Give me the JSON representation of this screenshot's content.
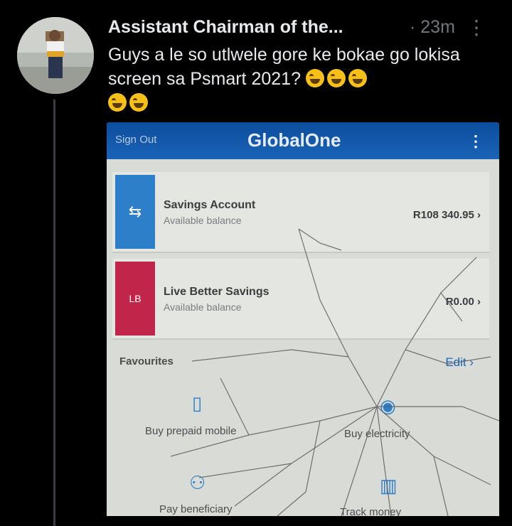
{
  "tweet": {
    "author": "Assistant Chairman of the...",
    "time": "· 23m",
    "more_icon": "more-vertical-icon",
    "text": "Guys a le so utlwele gore ke bokae go lokisa screen sa Psmart 2021?",
    "emoji": "rolling-on-floor-laughing"
  },
  "photo": {
    "sign_out": "Sign Out",
    "app_title": "GlobalOne",
    "accounts": [
      {
        "name": "Savings Account",
        "sub": "Available balance",
        "balance": "R108 340.95",
        "icon": "transfer-icon"
      },
      {
        "name": "Live Better Savings",
        "sub": "Available balance",
        "balance": "R0.00",
        "icon": "live-better-logo"
      }
    ],
    "favourites_label": "Favourites",
    "edit_label": "Edit",
    "tiles": [
      {
        "label": "Buy prepaid mobile",
        "icon": "phone-icon"
      },
      {
        "label": "Buy electricity",
        "icon": "bulb-icon"
      },
      {
        "label": "Pay beneficiary",
        "icon": "people-icon"
      },
      {
        "label": "Track money",
        "icon": "chart-icon"
      }
    ]
  }
}
